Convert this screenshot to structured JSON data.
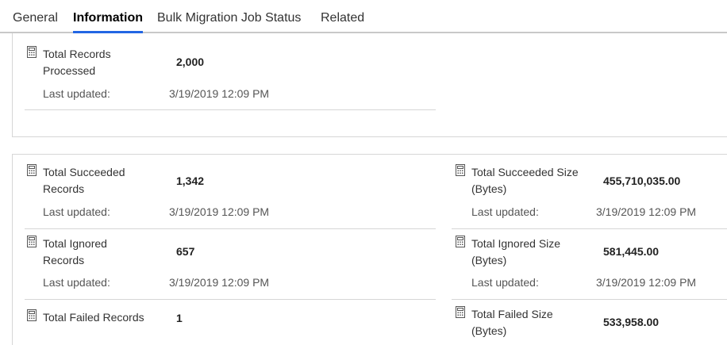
{
  "tabs": [
    {
      "label": "General",
      "active": false
    },
    {
      "label": "Information",
      "active": true
    },
    {
      "label": "Bulk Migration Job Status",
      "active": false
    },
    {
      "label": "Related",
      "active": false
    }
  ],
  "colors": {
    "accent": "#2266e3",
    "divider": "#d6d6d6"
  },
  "last_updated_label": "Last updated:",
  "fields": {
    "total_records_processed": {
      "label_line1": "Total Records",
      "label_line2": "Processed",
      "value": "2,000",
      "last_updated": "3/19/2019 12:09 PM"
    },
    "total_succeeded_records": {
      "label_line1": "Total Succeeded",
      "label_line2": "Records",
      "value": "1,342",
      "last_updated": "3/19/2019 12:09 PM"
    },
    "total_ignored_records": {
      "label_line1": "Total Ignored",
      "label_line2": "Records",
      "value": "657",
      "last_updated": "3/19/2019 12:09 PM"
    },
    "total_failed_records": {
      "label_line1": "Total Failed Records",
      "value": "1"
    },
    "total_succeeded_size": {
      "label_line1": "Total Succeeded Size",
      "label_line2": "(Bytes)",
      "value": "455,710,035.00",
      "last_updated": "3/19/2019 12:09 PM"
    },
    "total_ignored_size": {
      "label_line1": "Total Ignored Size",
      "label_line2": "(Bytes)",
      "value": "581,445.00",
      "last_updated": "3/19/2019 12:09 PM"
    },
    "total_failed_size": {
      "label_line1": "Total Failed Size",
      "label_line2": "(Bytes)",
      "value": "533,958.00"
    }
  }
}
